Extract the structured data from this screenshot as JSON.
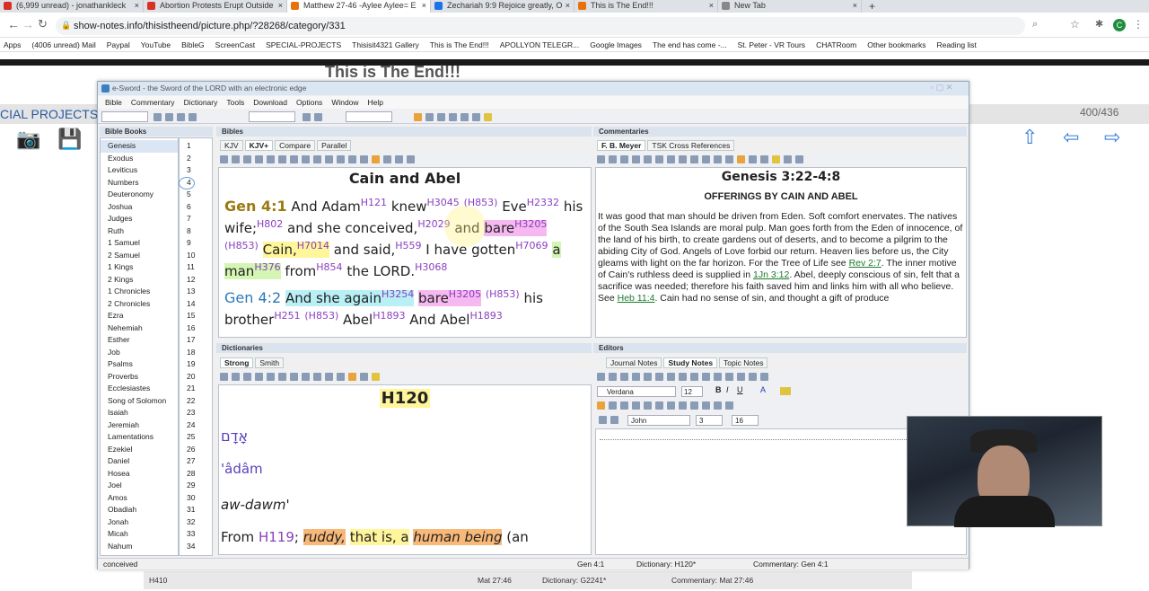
{
  "browser": {
    "tabs": [
      {
        "label": "(6,999 unread) - jonathankleck",
        "color": "#d93025"
      },
      {
        "label": "Abortion Protests Erupt Outside",
        "color": "#d93025"
      },
      {
        "label": "Matthew 27-46 -Aylee Aylee= E",
        "color": "#e8710a"
      },
      {
        "label": "Zechariah 9:9 Rejoice greatly, O",
        "color": "#1a73e8"
      },
      {
        "label": "This is The End!!!",
        "color": "#e8710a"
      },
      {
        "label": "New Tab",
        "color": "#888888"
      }
    ],
    "address": "show-notes.info/thisistheend/picture.php/?28268/category/331",
    "bookmarks": [
      "Apps",
      "(4006 unread) Mail",
      "Paypal",
      "YouTube",
      "BibleG",
      "ScreenCast",
      "SPECIAL-PROJECTS",
      "Thisisit4321 Gallery",
      "This is The End!!!",
      "APOLLYON TELEGR...",
      "Google Images",
      "The end has come -...",
      "St. Peter - VR Tours",
      "CHATRoom",
      "Other bookmarks",
      "Reading list"
    ]
  },
  "page": {
    "title": "This is The End!!!",
    "special": "CIAL PROJECTS",
    "counter": "400/436"
  },
  "esword": {
    "title": "e-Sword - the Sword of the LORD with an electronic edge",
    "menu": [
      "Bible",
      "Commentary",
      "Dictionary",
      "Tools",
      "Download",
      "Options",
      "Window",
      "Help"
    ],
    "books_header": "Bible Books",
    "books": [
      "Genesis",
      "Exodus",
      "Leviticus",
      "Numbers",
      "Deuteronomy",
      "Joshua",
      "Judges",
      "Ruth",
      "1 Samuel",
      "2 Samuel",
      "1 Kings",
      "2 Kings",
      "1 Chronicles",
      "2 Chronicles",
      "Ezra",
      "Nehemiah",
      "Esther",
      "Job",
      "Psalms",
      "Proverbs",
      "Ecclesiastes",
      "Song of Solomon",
      "Isaiah",
      "Jeremiah",
      "Lamentations",
      "Ezekiel",
      "Daniel",
      "Hosea",
      "Joel",
      "Amos",
      "Obadiah",
      "Jonah",
      "Micah",
      "Nahum"
    ],
    "chapters": [
      "1",
      "2",
      "3",
      "4",
      "5",
      "6",
      "7",
      "8",
      "9",
      "10",
      "11",
      "12",
      "13",
      "14",
      "15",
      "16",
      "17",
      "18",
      "19",
      "20",
      "21",
      "22",
      "23",
      "24",
      "25",
      "26",
      "27",
      "28",
      "29",
      "30",
      "31",
      "32",
      "33",
      "34"
    ],
    "bibles_header": "Bibles",
    "bible_tabs": [
      "KJV",
      "KJV+",
      "Compare",
      "Parallel"
    ],
    "passage_title": "Cain and Abel",
    "verse1_ref": "Gen 4:1",
    "verse2_ref": "Gen 4:2",
    "comm_header": "Commentaries",
    "comm_tabs": [
      "F. B. Meyer",
      "TSK Cross References"
    ],
    "comm_ref": "Genesis 3:22-4:8",
    "comm_heading": "OFFERINGS BY CAIN AND ABEL",
    "comm_text1": "It was good that man should be driven from Eden. Soft comfort enervates. The natives of the South Sea Islands are moral pulp. Man goes forth from the Eden of innocence, of the land of his birth, to create gardens out of deserts, and to become a pilgrim to the abiding City of God. Angels of Love forbid our return. Heaven lies before us, the City gleams with light on the far horizon. For the Tree of Life see",
    "comm_link1": "Rev 2:7",
    "comm_text2": ". The inner motive of Cain's ruthless deed is supplied in",
    "comm_link2": "1Jn 3:12",
    "comm_text3": ". Abel, deeply conscious of sin, felt that a sacrifice was needed; therefore his faith saved him and links him with all who believe. See",
    "comm_link3": "Heb 11:4",
    "comm_text4": ". Cain had no sense of sin, and thought a gift of produce",
    "dict_header": "Dictionaries",
    "dict_tabs": [
      "Strong",
      "Smith"
    ],
    "dict_entry": "H120",
    "dict_hebrew": "אָדָם",
    "dict_translit": "'âdâm",
    "dict_pron": "aw-dawm'",
    "dict_from": "From",
    "dict_from_ref": "H119",
    "dict_def1": "ruddy,",
    "dict_def2": "that is, a",
    "dict_def3": "human being",
    "dict_def4": "(an",
    "editors_header": "Editors",
    "editor_tabs": [
      "Journal Notes",
      "Study Notes",
      "Topic Notes"
    ],
    "font_name": "Verdana",
    "font_size": "12",
    "author": "John",
    "num1": "3",
    "num2": "16",
    "status": {
      "word": "conceived",
      "bible": "Gen 4:1",
      "dictionary": "Dictionary: H120*",
      "commentary": "Commentary: Gen 4:1"
    }
  },
  "bottom_status": {
    "a": "H410",
    "b": "Mat 27:46",
    "c": "Dictionary: G2241*",
    "d": "Commentary: Mat 27:46"
  }
}
